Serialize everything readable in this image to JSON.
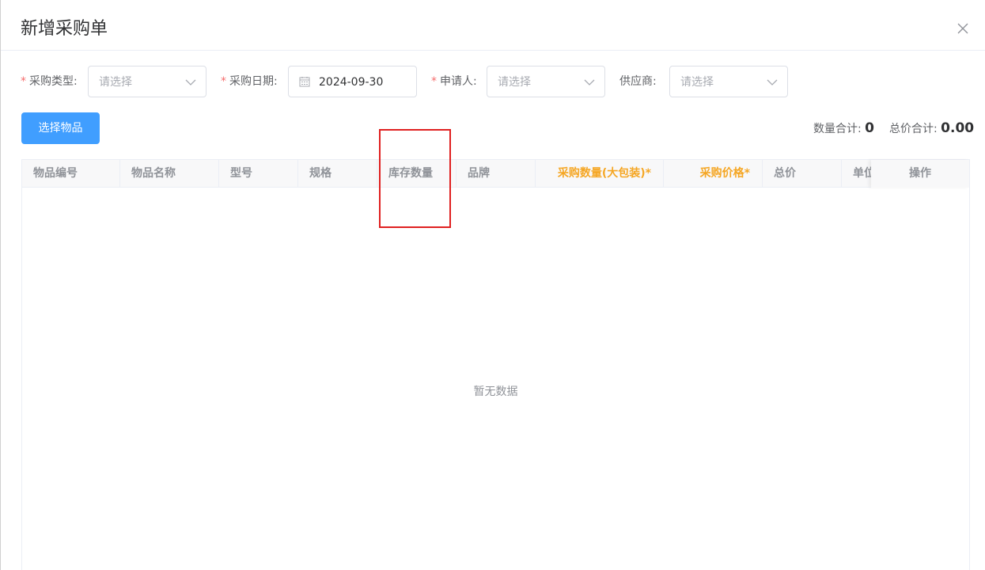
{
  "dialog": {
    "title": "新增采购单"
  },
  "form": {
    "purchase_type": {
      "label": "采购类型:",
      "placeholder": "请选择"
    },
    "purchase_date": {
      "label": "采购日期:",
      "value": "2024-09-30"
    },
    "applicant": {
      "label": "申请人:",
      "placeholder": "请选择"
    },
    "supplier": {
      "label": "供应商:",
      "placeholder": "请选择"
    },
    "required_mark": "*"
  },
  "toolbar": {
    "select_items_label": "选择物品",
    "qty_total_label": "数量合计:",
    "qty_total_value": "0",
    "price_total_label": "总价合计:",
    "price_total_value": "0.00"
  },
  "table": {
    "columns": [
      "物品编号",
      "物品名称",
      "型号",
      "规格",
      "库存数量",
      "品牌",
      "采购数量(大包装)*",
      "采购价格*",
      "总价",
      "单位",
      "操作"
    ],
    "empty_text": "暂无数据"
  },
  "colors": {
    "primary": "#409eff",
    "required": "#f56c6c",
    "orange_header": "#f5a623",
    "highlight_box": "#e02020"
  },
  "icons": {
    "close": "close-icon",
    "dropdown": "chevron-down-icon",
    "calendar": "calendar-icon"
  }
}
